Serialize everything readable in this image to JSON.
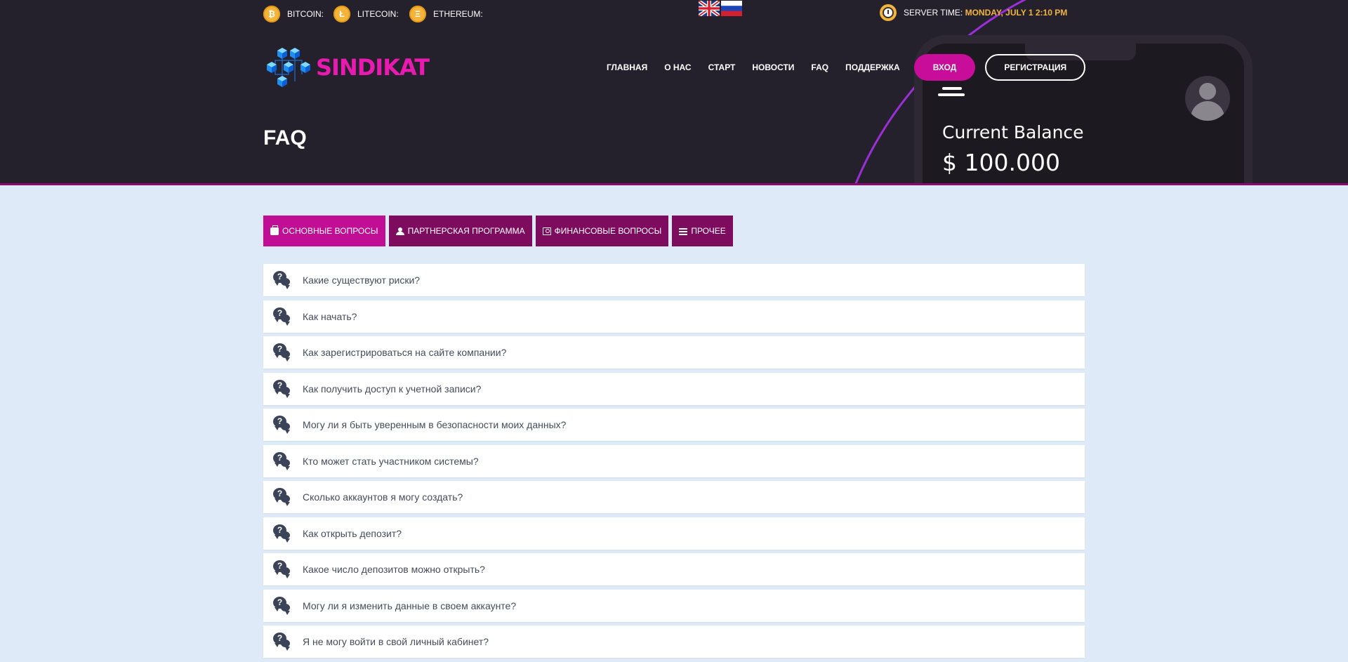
{
  "topbar": {
    "coins": [
      {
        "label": "BITCOIN:",
        "icon": "bitcoin-icon",
        "symbol": "₿"
      },
      {
        "label": "LITECOIN:",
        "icon": "litecoin-icon",
        "symbol": "Ł"
      },
      {
        "label": "ETHEREUM:",
        "icon": "ethereum-icon",
        "symbol": "Ξ"
      }
    ],
    "languages": [
      "en-flag",
      "ru-flag"
    ],
    "server_time_label": "SERVER TIME:",
    "server_time_value": "MONDAY, JULY 1 2:10 PM"
  },
  "brand": {
    "name": "SINDIKAT",
    "accent": "#e81aaf"
  },
  "nav": {
    "links": [
      "ГЛАВНАЯ",
      "О НАС",
      "СТАРТ",
      "НОВОСТИ",
      "FAQ",
      "ПОДДЕРЖКА"
    ],
    "login": "ВХОД",
    "register": "РЕГИСТРАЦИЯ"
  },
  "hero": {
    "title": "FAQ",
    "balance_label": "Current Balance",
    "balance_value": "$ 100.000"
  },
  "tabs": [
    {
      "label": "ОСНОВНЫЕ ВОПРОСЫ",
      "icon": "briefcase-icon",
      "active": true
    },
    {
      "label": "ПАРТНЕРСКАЯ ПРОГРАММА",
      "icon": "users-icon",
      "active": false
    },
    {
      "label": "ФИНАНСОВЫЕ ВОПРОСЫ",
      "icon": "money-icon",
      "active": false
    },
    {
      "label": "ПРОЧЕЕ",
      "icon": "list-icon",
      "active": false
    }
  ],
  "faq": [
    "Какие существуют риски?",
    "Как начать?",
    "Как зарегистрироваться на сайте компании?",
    "Как получить доступ к учетной записи?",
    "Могу ли я быть уверенным в безопасности моих данных?",
    "Кто может стать участником системы?",
    "Сколько аккаунтов я могу создать?",
    "Как открыть депозит?",
    "Какое число депозитов можно открыть?",
    "Могу ли я изменить данные в своем аккаунте?",
    "Я не могу войти в свой личный кабинет?"
  ],
  "colors": {
    "header_bg": "#25212c",
    "page_bg": "#deeaf8",
    "tab_active": "#c10f95",
    "tab_inactive": "#7d0c5f",
    "coin": "#f3b43c"
  }
}
